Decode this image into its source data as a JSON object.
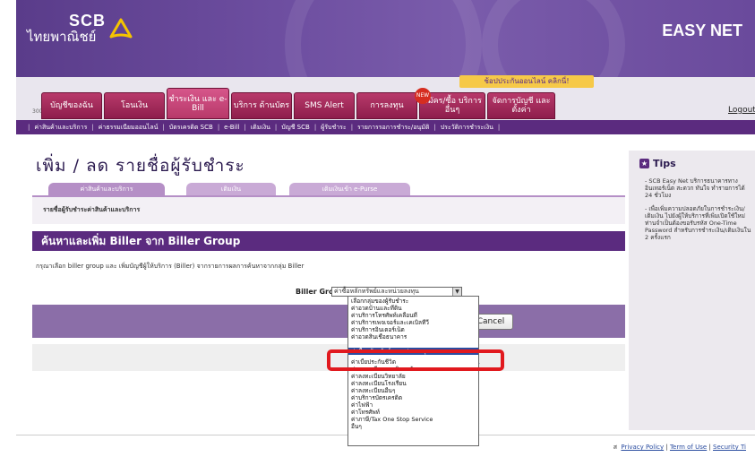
{
  "header": {
    "brand_en": "SCB",
    "brand_th": "ไทยพาณิชย์",
    "product": "EASY NET",
    "promo": "ช้อปประกันออนไลน์ คลิกนี่!"
  },
  "tabs": [
    {
      "label": "บัญชีของฉัน"
    },
    {
      "label": "โอนเงิน"
    },
    {
      "label": "ชำระเงิน และ e-Bill"
    },
    {
      "label": "บริการ ด้านบัตร"
    },
    {
      "label": "SMS Alert"
    },
    {
      "label": "การลงทุน"
    },
    {
      "label": "สมัคร/ซื้อ บริการอื่นๆ",
      "badge": "NEW"
    },
    {
      "label": "จัดการบัญชี และตั้งค่า"
    }
  ],
  "small_number": "300",
  "logout": "Logout",
  "subnav": [
    "ค่าสินค้าและบริการ",
    "ค่าธรรมเนียมออนไลน์",
    "บัตรเครดิต SCB",
    "e-Bill",
    "เติมเงิน",
    "บัญชี SCB",
    "ผู้รับชำระ",
    "รายการรอการชำระ/อนุมัติ",
    "ประวัติการชำระเงิน"
  ],
  "page_title": "เพิ่ม / ลด รายชื่อผู้รับชำระ",
  "subtabs": [
    "ค่าสินค้าและบริการ",
    "เติมเงิน",
    "เติมเงินเข้า e-Purse"
  ],
  "panel_label": "รายชื่อผู้รับชำระค่าสินค้าและบริการ",
  "section_title": "ค้นหาและเพิ่ม Biller จาก Biller Group",
  "instruction": "กรุณาเลือก biller group และ เพิ่มบัญชีผู้ให้บริการ (Biller) จากรายการผลการค้นหาจากกลุ่ม Biller",
  "biller_group_label": "Biller Group:",
  "biller_group_value": "ค่าซื้อหลักทรัพย์และหน่วยลงทุน",
  "cancel": "Cancel",
  "blue_fragment": "ster",
  "dropdown_options": [
    "เลือกกลุ่มของผู้รับชำระ",
    "ค่าอวดบ้านและที่ดิน",
    "ค่าบริการโทรศัพท์เคลื่อนที่",
    "ค่าบริการเพจเจอร์และเคเบิลทีวี",
    "ค่าบริการอินเตอร์เน็ต",
    "ค่าอวดสินเชื่อธนาคาร",
    "ค่าซื้อหลักทรัพย์และหน่วยลงทุน",
    "ค่าเบี้ยประกันชีวิต",
    "ค่าลงทะเบียนมหาวิทยาลัย",
    "ค่าลงทะเบียนวิทยาลัย",
    "ค่าลงทะเบียนโรงเรียน",
    "ค่าลงทะเบียนอื่นๆ",
    "ค่าบริการบัตรเครดิต",
    "ค่าไฟฟ้า",
    "ค่าโทรศัพท์",
    "ค่าภาษี/Tax One Stop Service",
    "อื่นๆ"
  ],
  "tips": {
    "title": "Tips",
    "items": [
      "- SCB Easy Net บริการธนาคารทางอินเทอร์เน็ต สะดวก ทันใจ ทำรายการได้ 24 ชั่วโมง",
      "- เพื่อเพิ่มความปลอดภัยในการชำระเงิน/เติมเงิน ไปยังผู้ให้บริการที่เพิ่มเปิดใช้ใหม่ ท่านจำเป็นต้องขอรับรหัส One-Time Password สำหรับการชำระเงิน/เติมเงินใน 2 ครั้งแรก"
    ]
  },
  "footer": {
    "prefix": "ส",
    "links": [
      "Privacy Policy",
      "Term of Use",
      "Security Ti"
    ]
  },
  "colors": {
    "brand_purple": "#5b2b7f",
    "tab_magenta": "#b8396a",
    "highlight_red": "#e1191e"
  }
}
